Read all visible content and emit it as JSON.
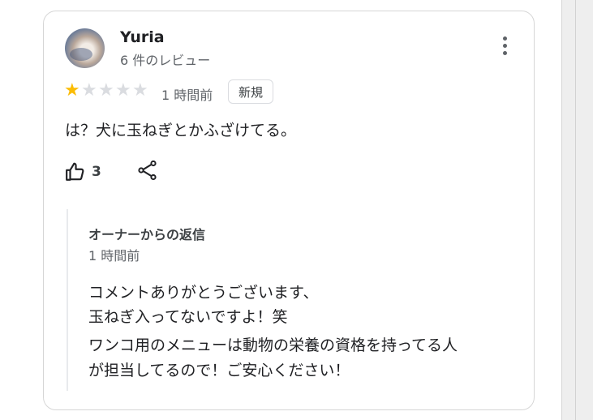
{
  "review": {
    "author": "Yuria",
    "review_count": "6 件のレビュー",
    "rating": 1,
    "rating_max": 5,
    "time_ago": "1 時間前",
    "badge": "新規",
    "text": "は？犬に玉ねぎとかふざけてる。",
    "like_count": "3",
    "icons": {
      "more": "more-vert-icon",
      "like": "thumbs-up-icon",
      "share": "share-icon",
      "star": "star-icon"
    },
    "colors": {
      "star_filled": "#fbbc04",
      "star_empty": "#dadce0"
    }
  },
  "owner_reply": {
    "title": "オーナーからの返信",
    "time_ago": "1 時間前",
    "lines": [
      "コメントありがとうございます、",
      "玉ねぎ入ってないですよ！笑",
      "ワンコ用のメニューは動物の栄養の資格を持ってる人",
      "が担当してるので！ご安心ください！"
    ]
  }
}
